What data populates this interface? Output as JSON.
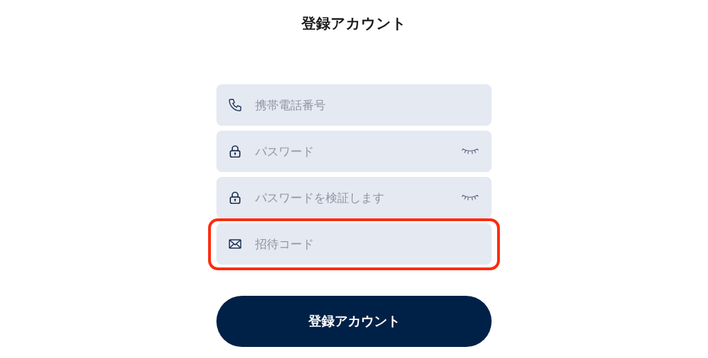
{
  "title": "登録アカウント",
  "fields": [
    {
      "kind": "phone",
      "placeholder": "携帯電話番号",
      "highlighted": false
    },
    {
      "kind": "password",
      "placeholder": "パスワード",
      "highlighted": false
    },
    {
      "kind": "password",
      "placeholder": "パスワードを検証します",
      "highlighted": false
    },
    {
      "kind": "email",
      "placeholder": "招待コード",
      "highlighted": true
    }
  ],
  "submit_button": "登録アカウント"
}
